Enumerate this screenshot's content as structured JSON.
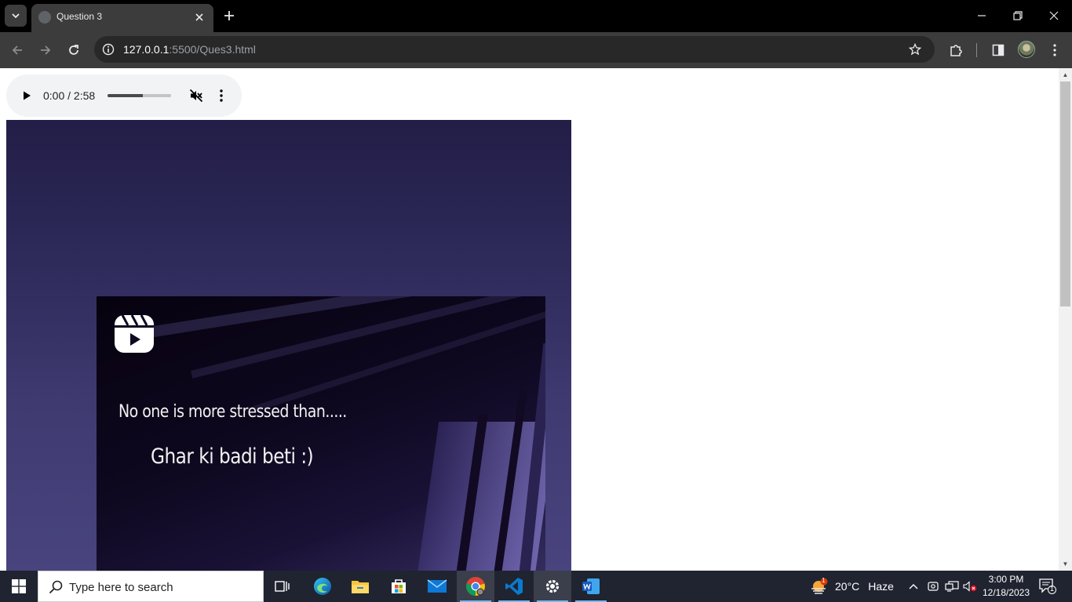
{
  "browser": {
    "tab_title": "Question 3",
    "url_host": "127.0.0.1",
    "url_path": ":5500/Ques3.html"
  },
  "audio_player": {
    "time_display": "0:00 / 2:58",
    "volume_level": 0.55,
    "muted": true
  },
  "media": {
    "caption_line1": "No one is more stressed than.....",
    "caption_line2": "Ghar ki badi beti :)"
  },
  "taskbar": {
    "search_placeholder": "Type here to search",
    "weather_temp": "20°C",
    "weather_condition": "Haze",
    "weather_badge": "1",
    "time": "3:00 PM",
    "date": "12/18/2023",
    "notification_count": "1",
    "apps": [
      "task-view",
      "edge",
      "file-explorer",
      "microsoft-store",
      "mail",
      "chrome",
      "vscode",
      "settings",
      "word"
    ]
  },
  "colors": {
    "chrome_dark": "#3c3c3c",
    "taskbar": "#1f2430",
    "media_bg": "#2e2a5a"
  }
}
